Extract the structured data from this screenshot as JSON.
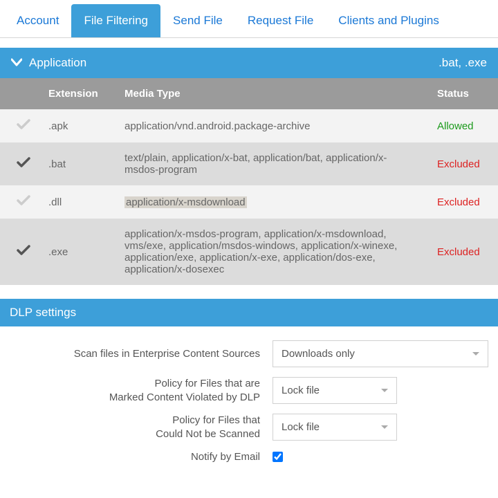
{
  "tabs": {
    "account": "Account",
    "file_filtering": "File Filtering",
    "send_file": "Send File",
    "request_file": "Request File",
    "clients_plugins": "Clients and Plugins"
  },
  "section": {
    "title": "Application",
    "summary": ".bat, .exe"
  },
  "columns": {
    "extension": "Extension",
    "media_type": "Media Type",
    "status": "Status"
  },
  "rows": [
    {
      "checked": false,
      "ext": ".apk",
      "media": "application/vnd.android.package-archive",
      "status": "Allowed"
    },
    {
      "checked": true,
      "ext": ".bat",
      "media": "text/plain, application/x-bat, application/bat, application/x-msdos-program",
      "status": "Excluded"
    },
    {
      "checked": false,
      "ext": ".dll",
      "media": "application/x-msdownload",
      "status": "Excluded",
      "highlight": true
    },
    {
      "checked": true,
      "ext": ".exe",
      "media": "application/x-msdos-program, application/x-msdownload, vms/exe, application/msdos-windows, application/x-winexe, application/exe, application/x-exe, application/dos-exe, application/x-dosexec",
      "status": "Excluded"
    }
  ],
  "dlp": {
    "header": "DLP settings",
    "scan_label": "Scan files in Enterprise Content Sources",
    "scan_value": "Downloads only",
    "violated_label_l1": "Policy for Files that are",
    "violated_label_l2": "Marked Content Violated by DLP",
    "violated_value": "Lock file",
    "noscan_label_l1": "Policy for Files that",
    "noscan_label_l2": "Could Not be Scanned",
    "noscan_value": "Lock file",
    "notify_label": "Notify by Email",
    "notify_checked": true
  }
}
